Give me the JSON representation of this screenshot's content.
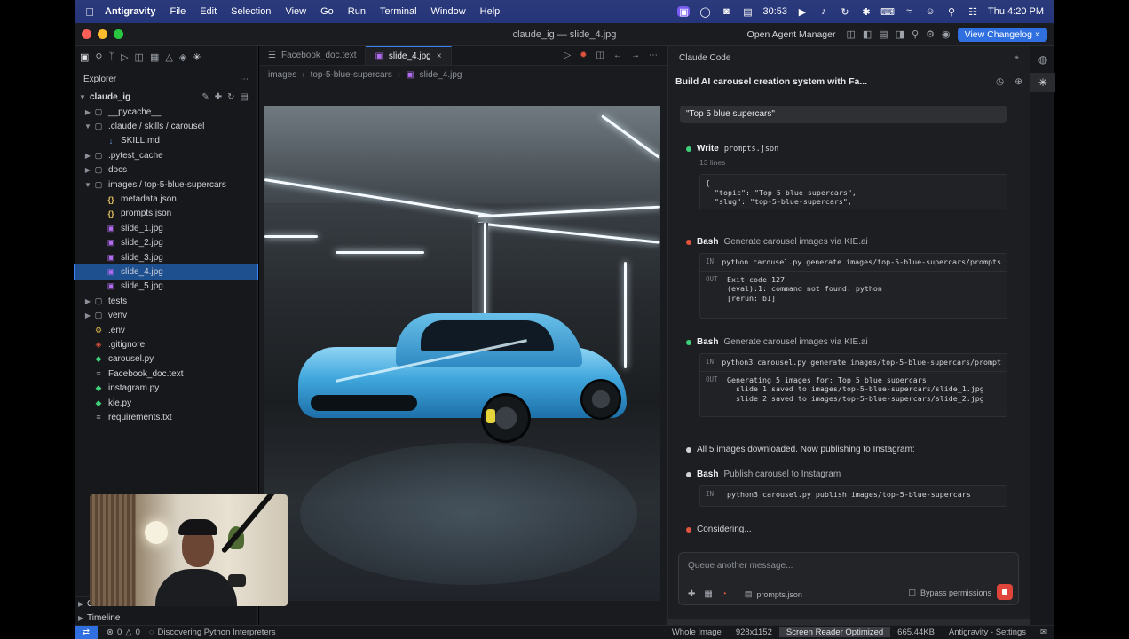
{
  "menubar": {
    "app_name": "Antigravity",
    "items": [
      "File",
      "Edit",
      "Selection",
      "View",
      "Go",
      "Run",
      "Terminal",
      "Window",
      "Help"
    ],
    "timer": "30:53",
    "clock": "Thu 4:20 PM"
  },
  "window": {
    "title": "claude_ig — slide_4.jpg",
    "open_agent_manager": "Open Agent Manager",
    "changelog_button": "View Changelog"
  },
  "sidebar": {
    "header": "Explorer",
    "root": "claude_ig",
    "tree": [
      {
        "label": "__pycache__",
        "type": "folder",
        "depth": 1,
        "expanded": false
      },
      {
        "label": ".claude / skills / carousel",
        "type": "folder",
        "depth": 1,
        "expanded": true
      },
      {
        "label": "SKILL.md",
        "type": "md",
        "depth": 2
      },
      {
        "label": ".pytest_cache",
        "type": "folder",
        "depth": 1,
        "expanded": false
      },
      {
        "label": "docs",
        "type": "folder",
        "depth": 1,
        "expanded": false
      },
      {
        "label": "images / top-5-blue-supercars",
        "type": "folder",
        "depth": 1,
        "expanded": true
      },
      {
        "label": "metadata.json",
        "type": "json",
        "depth": 2
      },
      {
        "label": "prompts.json",
        "type": "json",
        "depth": 2
      },
      {
        "label": "slide_1.jpg",
        "type": "img",
        "depth": 2
      },
      {
        "label": "slide_2.jpg",
        "type": "img",
        "depth": 2
      },
      {
        "label": "slide_3.jpg",
        "type": "img",
        "depth": 2
      },
      {
        "label": "slide_4.jpg",
        "type": "img",
        "depth": 2,
        "selected": true
      },
      {
        "label": "slide_5.jpg",
        "type": "img",
        "depth": 2
      },
      {
        "label": "tests",
        "type": "folder",
        "depth": 1,
        "expanded": false
      },
      {
        "label": "venv",
        "type": "folder",
        "depth": 1,
        "expanded": false
      },
      {
        "label": ".env",
        "type": "env",
        "depth": 1
      },
      {
        "label": ".gitignore",
        "type": "git",
        "depth": 1
      },
      {
        "label": "carousel.py",
        "type": "py",
        "depth": 1
      },
      {
        "label": "Facebook_doc.text",
        "type": "txt",
        "depth": 1
      },
      {
        "label": "instagram.py",
        "type": "py",
        "depth": 1
      },
      {
        "label": "kie.py",
        "type": "py",
        "depth": 1
      },
      {
        "label": "requirements.txt",
        "type": "txt",
        "depth": 1
      }
    ],
    "outline": "Ou",
    "timeline": "Timeline"
  },
  "editor": {
    "tabs": [
      {
        "label": "Facebook_doc.text",
        "active": false
      },
      {
        "label": "slide_4.jpg",
        "active": true
      }
    ],
    "breadcrumb": [
      "images",
      "top-5-blue-supercars",
      "slide_4.jpg"
    ]
  },
  "claude": {
    "panel_title": "Claude Code",
    "session_title": "Build AI carousel creation system with Fa...",
    "user_message": "\"Top 5 blue supercars\"",
    "steps": {
      "write": {
        "tool": "Write",
        "file": "prompts.json",
        "meta": "13 lines",
        "lines": [
          "{",
          "  \"topic\": \"Top 5 blue supercars\",",
          "  \"slug\": \"top-5-blue-supercars\","
        ]
      },
      "bash1": {
        "tool": "Bash",
        "desc": "Generate carousel images via KIE.ai",
        "in_label": "IN",
        "out_label": "OUT",
        "in": "python carousel.py generate images/top-5-blue-supercars/prompts",
        "out": [
          "Exit code 127",
          "(eval):1: command not found: python",
          "[rerun: b1]"
        ]
      },
      "bash2": {
        "tool": "Bash",
        "desc": "Generate carousel images via KIE.ai",
        "in_label": "IN",
        "out_label": "OUT",
        "in": "python3 carousel.py generate images/top-5-blue-supercars/prompt",
        "out": [
          "Generating 5 images for: Top 5 blue supercars",
          "  slide 1 saved to images/top-5-blue-supercars/slide_1.jpg",
          "  slide 2 saved to images/top-5-blue-supercars/slide_2.jpg"
        ]
      },
      "note": "All 5 images downloaded. Now publishing to Instagram:",
      "bash3": {
        "tool": "Bash",
        "desc": "Publish carousel to Instagram",
        "in_label": "IN",
        "in": "python3 carousel.py publish images/top-5-blue-supercars"
      },
      "thinking": "Considering..."
    },
    "composer": {
      "placeholder": "Queue another message...",
      "file_chip": "prompts.json",
      "bypass": "Bypass permissions"
    }
  },
  "statusbar": {
    "problems": "0",
    "warnings": "0",
    "task": "Discovering Python Interpreters",
    "mode": "Whole Image",
    "dimensions": "928x1152",
    "screen_reader": "Screen Reader Optimized",
    "size": "665.44KB",
    "settings": "Antigravity - Settings"
  },
  "colors": {
    "accent": "#2f6fe0",
    "selection": "#1e4f8f",
    "success_dot": "#3fd07a",
    "error_dot": "#e0533d",
    "menubar": "#26357a"
  }
}
